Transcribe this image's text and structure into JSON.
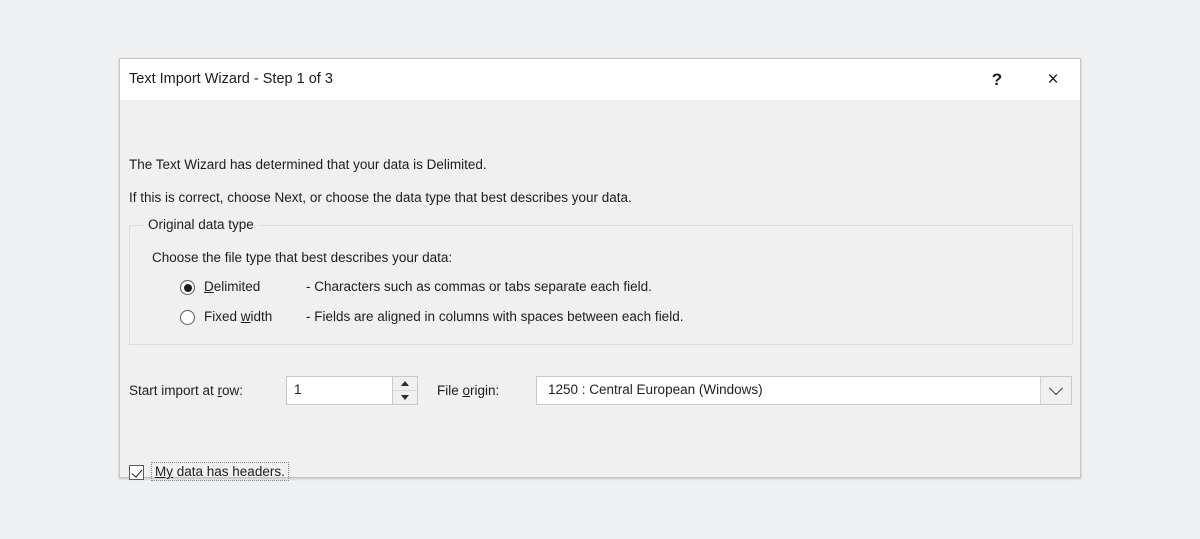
{
  "dialog": {
    "title": "Text Import Wizard - Step 1 of 3",
    "help_glyph": "?",
    "close_glyph": "×",
    "description_line_1": "The Text Wizard has determined that your data is Delimited.",
    "description_line_2": "If this is correct, choose Next, or choose the data type that best describes your data.",
    "group": {
      "legend": "Original data type",
      "instruction": "Choose the file type that best describes your data:",
      "options": [
        {
          "label_prefix": "",
          "label_accel": "D",
          "label_suffix": "elimited",
          "label_full": "Delimited",
          "description": "- Characters such as commas or tabs separate each field.",
          "selected": true
        },
        {
          "label_prefix": "Fixed ",
          "label_accel": "w",
          "label_suffix": "idth",
          "label_full": "Fixed width",
          "description": "- Fields are aligned in columns with spaces between each field.",
          "selected": false
        }
      ]
    },
    "start_import": {
      "label_prefix": "Start import at ",
      "label_accel": "r",
      "label_suffix": "ow:",
      "label_full": "Start import at row:",
      "value": "1",
      "spin_up": "▲",
      "spin_down": "▼"
    },
    "file_origin": {
      "label_prefix": "File ",
      "label_accel": "o",
      "label_suffix": "rigin:",
      "label_full": "File origin:",
      "selected_value": "1250 : Central European (Windows)"
    },
    "headers_checkbox": {
      "label_prefix": "",
      "label_accel": "My",
      "label_suffix": " data has headers.",
      "label_full": "My data has headers.",
      "checked": true
    }
  },
  "colors": {
    "page_background": "#eef0f1",
    "dialog_background": "#f0f0f0",
    "titlebar_background": "#ffffff",
    "text": "#1d1d1d",
    "border": "#c6c6c6",
    "field_background": "#ffffff"
  }
}
